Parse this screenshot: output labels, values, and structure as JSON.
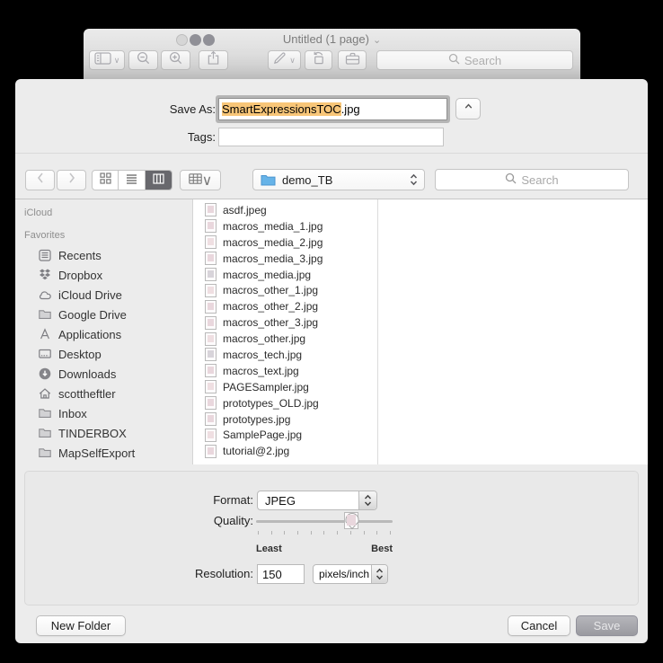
{
  "colors": {
    "selection_highlight": "#f8c678",
    "folder_blue": "#66b3e8",
    "save_button_gray": "#a5a5ab",
    "selected_segment_gray": "#68686d"
  },
  "window": {
    "title": "Untitled (1 page)",
    "search_placeholder": "Search"
  },
  "dialog": {
    "save_as_label": "Save As:",
    "filename_selected": "SmartExpressionsTOC",
    "filename_extension": ".jpg",
    "tags_label": "Tags:",
    "tags_value": "",
    "location": "demo_TB",
    "search_placeholder": "Search",
    "sidebar": {
      "sections": [
        {
          "header": "iCloud",
          "items": []
        },
        {
          "header": "Favorites",
          "items": [
            {
              "label": "Recents",
              "icon": "recents-icon"
            },
            {
              "label": "Dropbox",
              "icon": "dropbox-icon"
            },
            {
              "label": "iCloud Drive",
              "icon": "icloud-drive-icon"
            },
            {
              "label": "Google Drive",
              "icon": "folder-icon"
            },
            {
              "label": "Applications",
              "icon": "applications-icon"
            },
            {
              "label": "Desktop",
              "icon": "desktop-icon"
            },
            {
              "label": "Downloads",
              "icon": "downloads-icon"
            },
            {
              "label": "scottheftler",
              "icon": "home-icon"
            },
            {
              "label": "Inbox",
              "icon": "folder-icon"
            },
            {
              "label": "TINDERBOX",
              "icon": "folder-icon"
            },
            {
              "label": "MapSelfExport",
              "icon": "folder-icon"
            }
          ]
        }
      ]
    },
    "files": [
      "asdf.jpeg",
      "macros_media_1.jpg",
      "macros_media_2.jpg",
      "macros_media_3.jpg",
      "macros_media.jpg",
      "macros_other_1.jpg",
      "macros_other_2.jpg",
      "macros_other_3.jpg",
      "macros_other.jpg",
      "macros_tech.jpg",
      "macros_text.jpg",
      "PAGESampler.jpg",
      "prototypes_OLD.jpg",
      "prototypes.jpg",
      "SamplePage.jpg",
      "tutorial@2.jpg"
    ],
    "format_label": "Format:",
    "format_value": "JPEG",
    "quality_label": "Quality:",
    "quality_least": "Least",
    "quality_best": "Best",
    "quality_percent": 70,
    "quality_tick_count": 11,
    "resolution_label": "Resolution:",
    "resolution_value": "150",
    "resolution_unit": "pixels/inch",
    "new_folder_button": "New Folder",
    "cancel_button": "Cancel",
    "save_button": "Save"
  }
}
